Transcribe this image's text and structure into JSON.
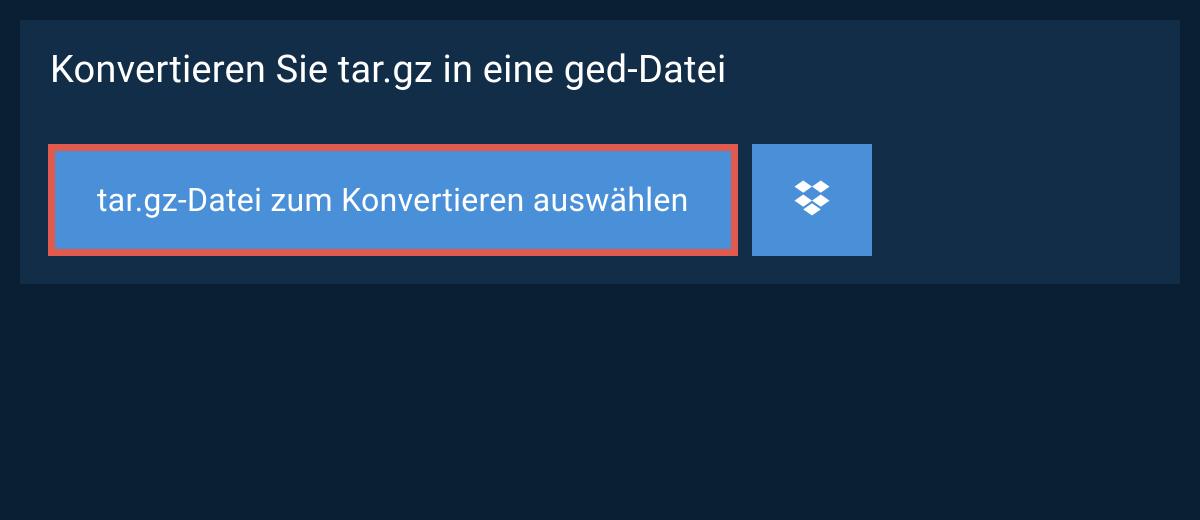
{
  "header": {
    "title": "Konvertieren Sie tar.gz in eine ged-Datei"
  },
  "actions": {
    "choose_file_label": "tar.gz-Datei zum Konvertieren auswählen"
  },
  "colors": {
    "page_bg": "#0a1f33",
    "panel_bg": "#122d47",
    "button_bg": "#4a90d9",
    "highlight_border": "#e05a4f"
  }
}
